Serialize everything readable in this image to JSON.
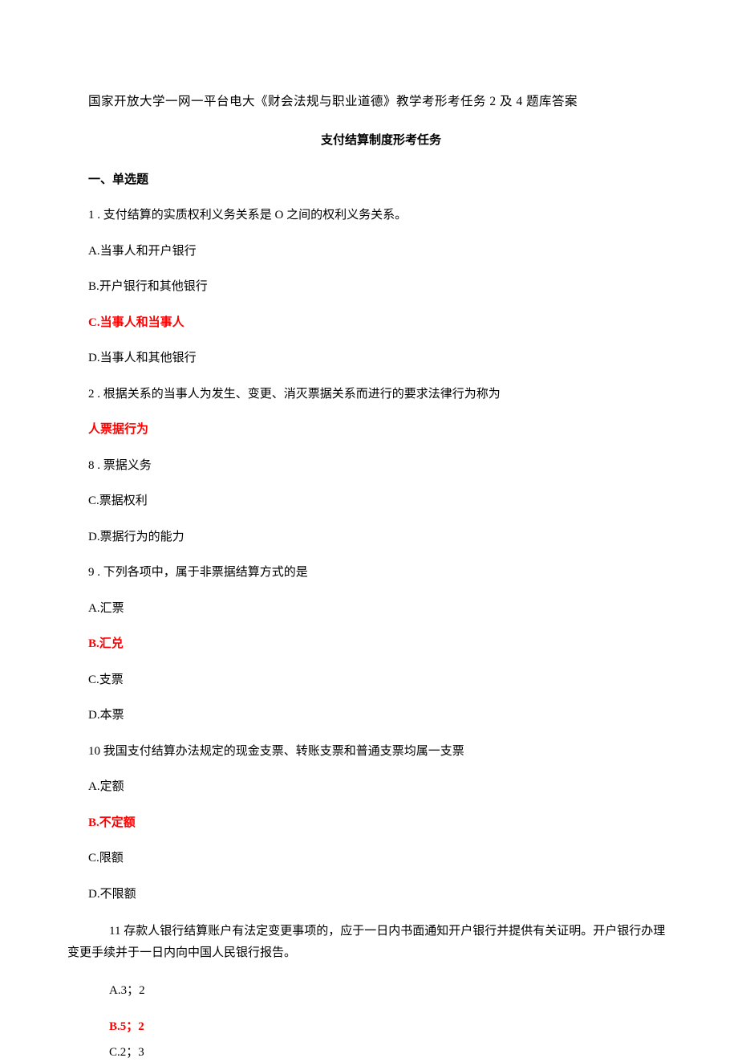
{
  "title": "国家开放大学一网一平台电大《财会法规与职业道德》教学考形考任务 2 及 4 题库答案",
  "subtitle": "支付结算制度形考任务",
  "section_heading": "一、单选题",
  "questions": [
    {
      "prompt": "1 . 支付结算的实质权利义务关系是 O 之间的权利义务关系。",
      "options": [
        {
          "label": "A.当事人和开户银行",
          "isAnswer": false
        },
        {
          "label": "B.开户银行和其他银行",
          "isAnswer": false
        },
        {
          "label": "C.当事人和当事人",
          "isAnswer": true
        },
        {
          "label": "D.当事人和其他银行",
          "isAnswer": false
        }
      ]
    },
    {
      "prompt": "2 . 根据关系的当事人为发生、变更、消灭票据关系而进行的要求法律行为称为",
      "options": [
        {
          "label": "人票据行为",
          "isAnswer": true
        },
        {
          "label": "8 . 票据义务",
          "isAnswer": false
        },
        {
          "label": "C.票据权利",
          "isAnswer": false
        },
        {
          "label": "D.票据行为的能力",
          "isAnswer": false
        }
      ]
    },
    {
      "prompt": "9 . 下列各项中，属于非票据结算方式的是",
      "options": [
        {
          "label": "A.汇票",
          "isAnswer": false
        },
        {
          "label": "B.汇兑",
          "isAnswer": true
        },
        {
          "label": "C.支票",
          "isAnswer": false
        },
        {
          "label": "D.本票",
          "isAnswer": false
        }
      ]
    },
    {
      "prompt": "10 我国支付结算办法规定的现金支票、转账支票和普通支票均属一支票",
      "options": [
        {
          "label": "A.定额",
          "isAnswer": false
        },
        {
          "label": "B.不定额",
          "isAnswer": true
        },
        {
          "label": "C.限额",
          "isAnswer": false
        },
        {
          "label": "D.不限额",
          "isAnswer": false
        }
      ]
    },
    {
      "prompt_line1": "11 存款人银行结算账户有法定变更事项的，应于一日内书面通知开户银行并提供有关证明。开户银行办理",
      "prompt_line2": "变更手续并于一日内向中国人民银行报告。",
      "options": [
        {
          "label": "A.3；2",
          "isAnswer": false
        },
        {
          "label": "B.5；2",
          "isAnswer": true
        },
        {
          "label": "C.2；3",
          "isAnswer": false
        }
      ]
    }
  ]
}
